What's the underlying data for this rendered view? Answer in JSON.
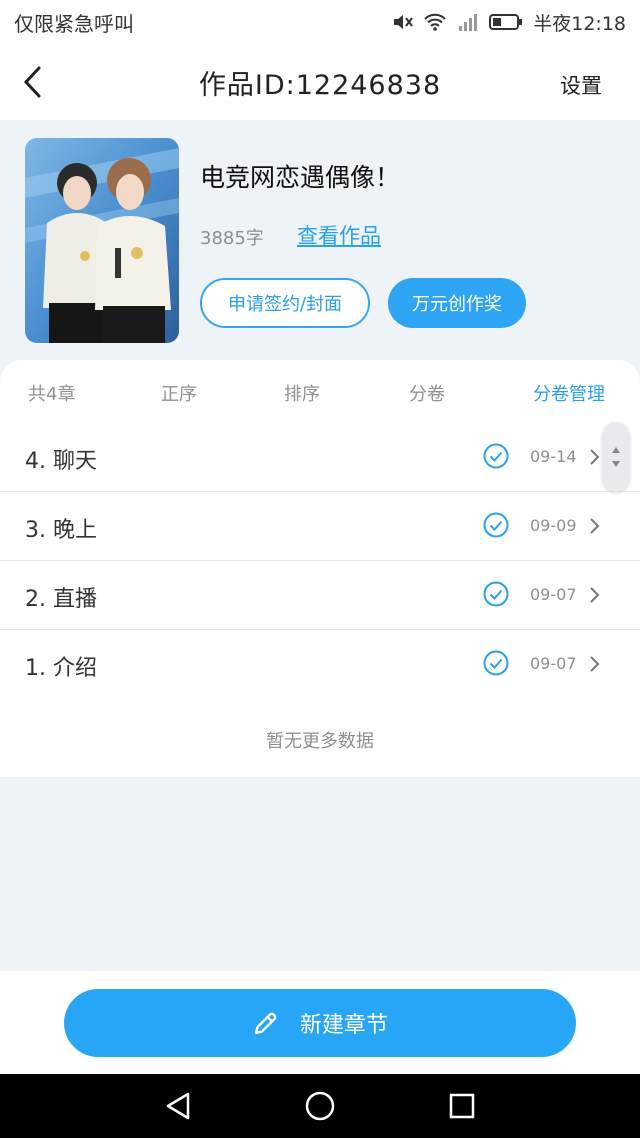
{
  "status_bar": {
    "carrier": "仅限紧急呼叫",
    "time": "半夜12:18"
  },
  "header": {
    "title": "作品ID:12246838",
    "settings_label": "设置"
  },
  "work": {
    "title": "电竞网恋遇偶像！",
    "word_count": "3885字",
    "view_link": "查看作品",
    "apply_button": "申请签约/封面",
    "award_button": "万元创作奖"
  },
  "tabs": {
    "total": "共4章",
    "asc": "正序",
    "sort": "排序",
    "volume": "分卷",
    "volume_manage": "分卷管理"
  },
  "chapters": [
    {
      "name": "4. 聊天",
      "date": "09-14"
    },
    {
      "name": "3. 晚上",
      "date": "09-09"
    },
    {
      "name": "2. 直播",
      "date": "09-07"
    },
    {
      "name": "1. 介绍",
      "date": "09-07"
    }
  ],
  "no_more": "暂无更多数据",
  "bottom": {
    "new_chapter_label": "新建章节"
  },
  "colors": {
    "accent": "#2ea4f5",
    "background": "#eef3f8"
  }
}
